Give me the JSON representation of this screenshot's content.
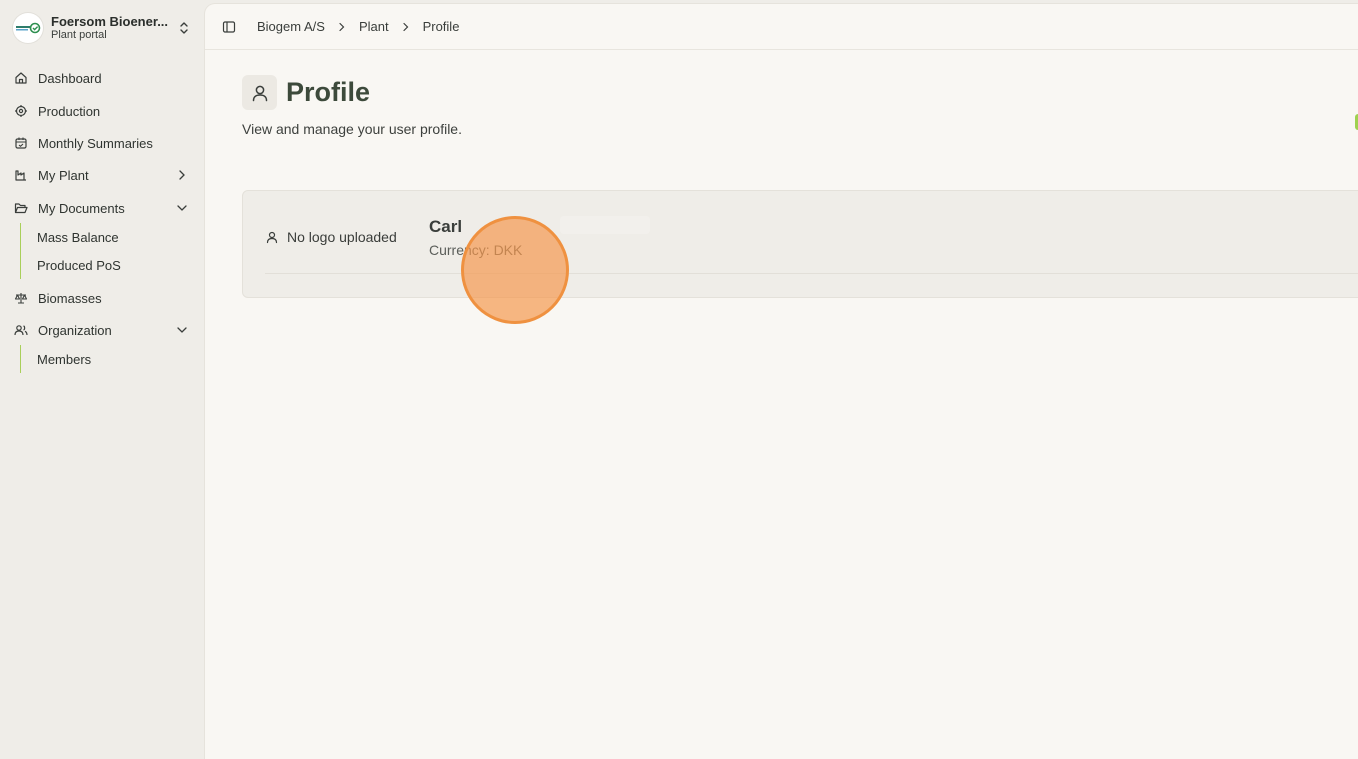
{
  "org": {
    "name": "Foersom Bioener...",
    "subtitle": "Plant portal"
  },
  "sidebar": {
    "items": [
      {
        "label": "Dashboard",
        "icon": "home-icon"
      },
      {
        "label": "Production",
        "icon": "production-gear-icon"
      },
      {
        "label": "Monthly Summaries",
        "icon": "calendar-icon"
      },
      {
        "label": "My Plant",
        "icon": "factory-icon"
      },
      {
        "label": "My Documents",
        "icon": "folder-open-icon"
      },
      {
        "label": "Biomasses",
        "icon": "scale-icon"
      },
      {
        "label": "Organization",
        "icon": "users-icon"
      }
    ],
    "documents_sub": [
      "Mass Balance",
      "Produced PoS"
    ],
    "organization_sub": [
      "Members"
    ]
  },
  "breadcrumb": [
    "Biogem A/S",
    "Plant",
    "Profile"
  ],
  "page": {
    "title": "Profile",
    "description": "View and manage your user profile."
  },
  "profile": {
    "logo_status": "No logo uploaded",
    "name": "Carl",
    "currency": "Currency: DKK"
  },
  "colors": {
    "accent": "#a9cf5a",
    "cursor": "#ef9140",
    "title": "#3d4a3b"
  }
}
